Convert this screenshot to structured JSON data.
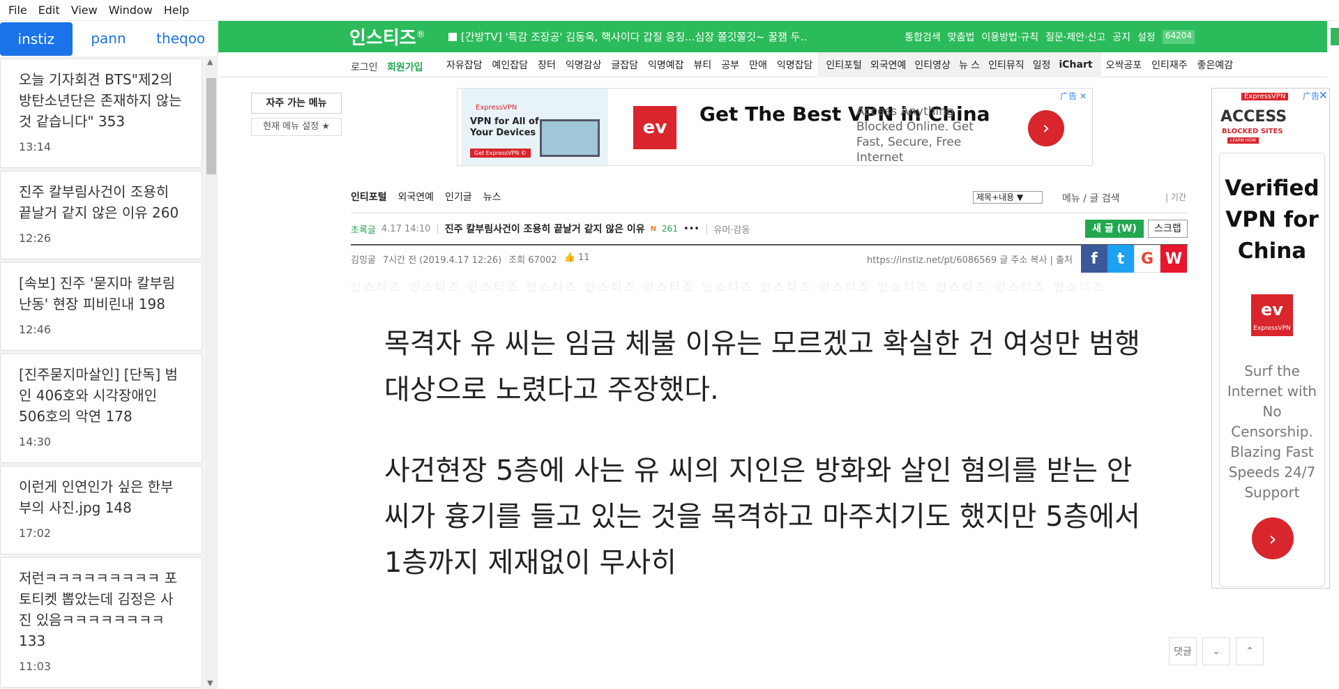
{
  "menubar": [
    "File",
    "Edit",
    "View",
    "Window",
    "Help"
  ],
  "sidebar": {
    "tabs": [
      "instiz",
      "pann",
      "theqoo"
    ],
    "items": [
      {
        "title": "오늘 기자회견 BTS\"제2의 방탄소년단은 존재하지 않는 것 같습니다\" 353",
        "time": "13:14"
      },
      {
        "title": "진주 칼부림사건이 조용히 끝날거 같지 않은 이유 260",
        "time": "12:26"
      },
      {
        "title": "[속보] 진주 '묻지마 칼부림 난동' 현장 피비린내 198",
        "time": "12:46"
      },
      {
        "title": "[진주묻지마살인] [단독] 범인 406호와 시각장애인 506호의 악연 178",
        "time": "14:30"
      },
      {
        "title": "이런게 인연인가 싶은 한부부의 사진.jpg 148",
        "time": "17:02"
      },
      {
        "title": "저런ㅋㅋㅋㅋㅋㅋㅋㅋㅋ 포토티켓 뽑았는데 김정은 사진 있음ㅋㅋㅋㅋㅋㅋㅋㅋ 133",
        "time": "11:03"
      }
    ]
  },
  "site": {
    "logo": "인스티즈",
    "logo_mark": "®",
    "ticker": "[간방TV] '특감 조장공' 김동욱, 핵사이다 갑질 응징...심장 쫄깃쫄깃~ 꿀잼 두..",
    "toplinks": [
      "통합검색",
      "맞춤법",
      "이용방법·규칙",
      "질문·제안·신고",
      "공지",
      "설정"
    ],
    "badge": "64204",
    "login": "로그인",
    "join": "회원가입",
    "cats_a": [
      "자유잡담",
      "예인잡담",
      "장터",
      "익명감상",
      "글잡담",
      "익명예잡",
      "뷰티",
      "공부",
      "만애",
      "익명잡담"
    ],
    "cats_b": [
      "인티포털",
      "외국연예",
      "인티영상",
      "뉴 스",
      "인티뮤직",
      "일정"
    ],
    "ichart": "iChart",
    "cats_c": [
      "오싹공포",
      "인티재주",
      "좋은예감"
    ],
    "fav_menu": "자주 가는 메뉴",
    "menu_setting": "현재 메뉴 설정 ★"
  },
  "ad1": {
    "label": "广告 ✕",
    "brand": "ExpressVPN",
    "img_text": "VPN for All of Your Devices",
    "img_btn": "Get ExpressVPN ©",
    "logo": "ev",
    "headline": "Get The Best VPN in China",
    "sub": "Access Anything Blocked Online. Get Fast, Secure, Free Internet",
    "go": "›"
  },
  "board": {
    "nav": [
      "인티포털",
      "외국연예",
      "인기글",
      "뉴스"
    ],
    "search_select": "제목+내용  ▼",
    "search_text": "메뉴 / 글 검색",
    "period": "| 기간",
    "green_label": "초록글",
    "date": "4.17 14:10",
    "title": "진주 칼부림사건이 조용히 끝날거 같지 않은 이유",
    "new_mark": "N",
    "comments": "261",
    "more": "•••",
    "category": "유머·감동",
    "new_btn": "새 글 (W)",
    "scrap_btn": "스크랩",
    "author": "김밍굴",
    "posted": "7시간 전 (2019.4.17 12:26)",
    "views": "조회 67002",
    "likes": "👍 11",
    "url": "https://instiz.net/pt/6086569  글 주소 복사  |  출처",
    "watermark": "인스티즈 인스티즈 인스티즈 인스티즈 인스티즈 인스티즈 인스티즈 인스티즈 인스티즈 인스티즈 인스티즈 인스티즈 인스티즈"
  },
  "share": [
    {
      "name": "facebook",
      "glyph": "f",
      "color": "#3b5998"
    },
    {
      "name": "twitter",
      "glyph": "t",
      "color": "#1da1f2"
    },
    {
      "name": "google",
      "glyph": "G",
      "color": "#ffffff"
    },
    {
      "name": "weibo",
      "glyph": "W",
      "color": "#e6162d"
    }
  ],
  "content": [
    "목격자 유 씨는 임금 체불 이유는 모르겠고 확실한 건 여성만 범행 대상으로 노렸다고 주장했다.",
    "사건현장 5층에 사는 유 씨의 지인은 방화와 살인 혐의를 받는 안 씨가 흉기를 들고 있는 것을 목격하고 마주치기도 했지만 5층에서 1층까지 제재없이 무사히"
  ],
  "ad2": {
    "label": "广告",
    "close": "✕",
    "brand_small": "ExpressVPN",
    "access": "ACCESS",
    "blocked": "BLOCKED SITES",
    "learn": "LEARN HOW",
    "headline": "Verified VPN for China",
    "logo_text": "ExpressVPN",
    "logo_sym": "ev",
    "body": "Surf the Internet with No Censorship. Blazing Fast Speeds 24/7 Support",
    "go": "›"
  },
  "float": {
    "comment": "댓글",
    "down": "⌄",
    "up": "⌃"
  }
}
